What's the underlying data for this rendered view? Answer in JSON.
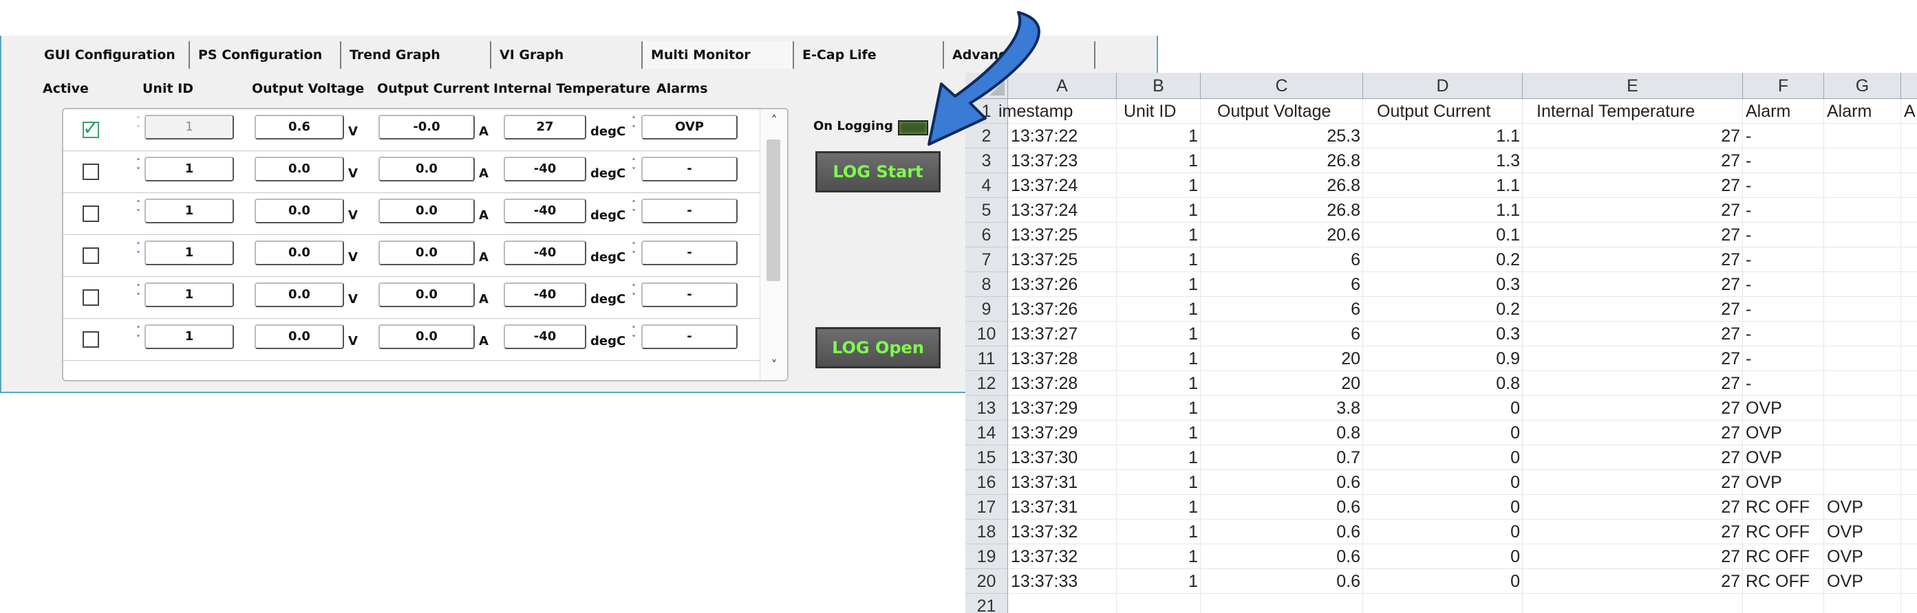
{
  "tabs": [
    {
      "label": "GUI Configuration"
    },
    {
      "label": "PS Configuration"
    },
    {
      "label": "Trend Graph"
    },
    {
      "label": "VI Graph"
    },
    {
      "label": "Multi Monitor",
      "active": true
    },
    {
      "label": "E-Cap Life"
    },
    {
      "label": "Advanced"
    }
  ],
  "columns": {
    "active": "Active",
    "unit_id": "Unit ID",
    "output_voltage": "Output Voltage",
    "output_current": "Output Current",
    "internal_temperature": "Internal Temperature",
    "alarms": "Alarms"
  },
  "units": {
    "voltage": "V",
    "current": "A",
    "temperature": "degC"
  },
  "spin_glyph": {
    "up": "˄",
    "down": "˅"
  },
  "monitor_rows": [
    {
      "active": true,
      "unit_id": "1",
      "voltage": "0.6",
      "current": "-0.0",
      "temperature": "27",
      "alarm": "OVP"
    },
    {
      "active": false,
      "unit_id": "1",
      "voltage": "0.0",
      "current": "0.0",
      "temperature": "-40",
      "alarm": "-"
    },
    {
      "active": false,
      "unit_id": "1",
      "voltage": "0.0",
      "current": "0.0",
      "temperature": "-40",
      "alarm": "-"
    },
    {
      "active": false,
      "unit_id": "1",
      "voltage": "0.0",
      "current": "0.0",
      "temperature": "-40",
      "alarm": "-"
    },
    {
      "active": false,
      "unit_id": "1",
      "voltage": "0.0",
      "current": "0.0",
      "temperature": "-40",
      "alarm": "-"
    },
    {
      "active": false,
      "unit_id": "1",
      "voltage": "0.0",
      "current": "0.0",
      "temperature": "-40",
      "alarm": "-"
    }
  ],
  "logging": {
    "status_label": "On Logging",
    "start_button": "LOG Start",
    "open_button": "LOG Open",
    "lamp_color": "#3b5a2b",
    "button_text_color": "#7dff4a"
  },
  "scroll": {
    "up": "˄",
    "down": "˅"
  },
  "sheet": {
    "column_letters": [
      "A",
      "B",
      "C",
      "D",
      "E",
      "F",
      "G",
      ""
    ],
    "header_row": [
      "imestamp",
      "Unit ID",
      "Output Voltage",
      "Output Current",
      "Internal Temperature",
      "Alarm",
      "Alarm",
      "A"
    ],
    "row_numbers": [
      "1",
      "2",
      "3",
      "4",
      "5",
      "6",
      "7",
      "8",
      "9",
      "10",
      "11",
      "12",
      "13",
      "14",
      "15",
      "16",
      "17",
      "18",
      "19",
      "20",
      "21"
    ],
    "data_rows": [
      [
        "13:37:22",
        "1",
        "25.3",
        "1.1",
        "27",
        "-",
        ""
      ],
      [
        "13:37:23",
        "1",
        "26.8",
        "1.3",
        "27",
        "-",
        ""
      ],
      [
        "13:37:24",
        "1",
        "26.8",
        "1.1",
        "27",
        "-",
        ""
      ],
      [
        "13:37:24",
        "1",
        "26.8",
        "1.1",
        "27",
        "-",
        ""
      ],
      [
        "13:37:25",
        "1",
        "20.6",
        "0.1",
        "27",
        "-",
        ""
      ],
      [
        "13:37:25",
        "1",
        "6",
        "0.2",
        "27",
        "-",
        ""
      ],
      [
        "13:37:26",
        "1",
        "6",
        "0.3",
        "27",
        "-",
        ""
      ],
      [
        "13:37:26",
        "1",
        "6",
        "0.2",
        "27",
        "-",
        ""
      ],
      [
        "13:37:27",
        "1",
        "6",
        "0.3",
        "27",
        "-",
        ""
      ],
      [
        "13:37:28",
        "1",
        "20",
        "0.9",
        "27",
        "-",
        ""
      ],
      [
        "13:37:28",
        "1",
        "20",
        "0.8",
        "27",
        "-",
        ""
      ],
      [
        "13:37:29",
        "1",
        "3.8",
        "0",
        "27",
        "OVP",
        ""
      ],
      [
        "13:37:29",
        "1",
        "0.8",
        "0",
        "27",
        "OVP",
        ""
      ],
      [
        "13:37:30",
        "1",
        "0.7",
        "0",
        "27",
        "OVP",
        ""
      ],
      [
        "13:37:31",
        "1",
        "0.6",
        "0",
        "27",
        "OVP",
        ""
      ],
      [
        "13:37:31",
        "1",
        "0.6",
        "0",
        "27",
        "RC OFF",
        "OVP"
      ],
      [
        "13:37:32",
        "1",
        "0.6",
        "0",
        "27",
        "RC OFF",
        "OVP"
      ],
      [
        "13:37:32",
        "1",
        "0.6",
        "0",
        "27",
        "RC OFF",
        "OVP"
      ],
      [
        "13:37:33",
        "1",
        "0.6",
        "0",
        "27",
        "RC OFF",
        "OVP"
      ]
    ]
  },
  "arrow_color": "#3a7bd5"
}
